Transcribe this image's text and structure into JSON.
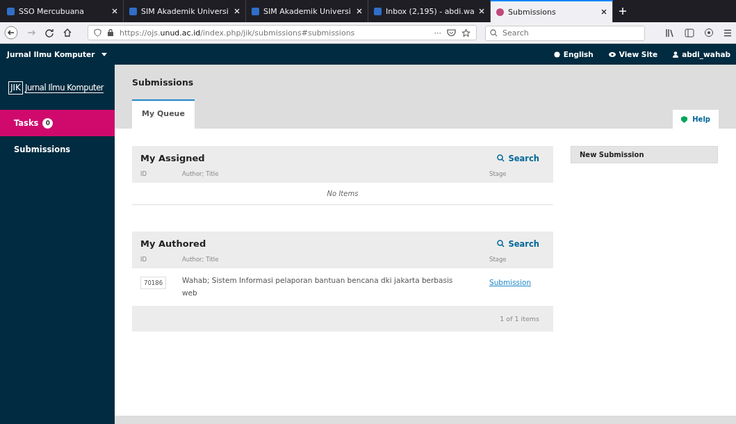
{
  "browser": {
    "tabs": [
      {
        "title": "SSO Mercubuana",
        "selected": false
      },
      {
        "title": "SIM Akademik Universi",
        "selected": false
      },
      {
        "title": "SIM Akademik Universi",
        "selected": false
      },
      {
        "title": "Inbox (2,195) - abdi.wa",
        "selected": false
      },
      {
        "title": "Submissions",
        "selected": true
      }
    ],
    "url": {
      "scheme": "https://ojs.",
      "host": "unud.ac.id",
      "path": "/index.php/jik/submissions#submissions"
    },
    "search": {
      "placeholder": "Search"
    },
    "more": "···"
  },
  "header": {
    "context": "Jurnal Ilmu Komputer",
    "links": [
      {
        "kind": "language",
        "label": "English"
      },
      {
        "kind": "site",
        "label": "View Site"
      },
      {
        "kind": "user",
        "label": "abdi_wahab"
      }
    ]
  },
  "sidebar": {
    "logo": {
      "mark": "JIK",
      "name": "Jurnal Ilmu Komputer"
    },
    "items": [
      {
        "label": "Tasks",
        "badge": "0",
        "selected": true
      },
      {
        "label": "Submissions",
        "selected": false
      }
    ]
  },
  "page": {
    "title": "Submissions",
    "tabs": [
      {
        "label": "My Queue",
        "selected": true
      }
    ],
    "help": "Help"
  },
  "lists": [
    {
      "title": "My Assigned",
      "search": "Search",
      "columns": [
        "ID",
        "Author; Title",
        "Stage"
      ],
      "empty": "No Items"
    },
    {
      "title": "My Authored",
      "search": "Search",
      "columns": [
        "ID",
        "Author; Title",
        "Stage"
      ],
      "rows": [
        {
          "id": "70186",
          "title": "Wahab; Sistem Informasi pelaporan bantuan bencana dki jakarta berbasis web",
          "stage": "Submission"
        }
      ],
      "footer": "1 of 1 items"
    }
  ],
  "actions": [
    "New Submission"
  ]
}
